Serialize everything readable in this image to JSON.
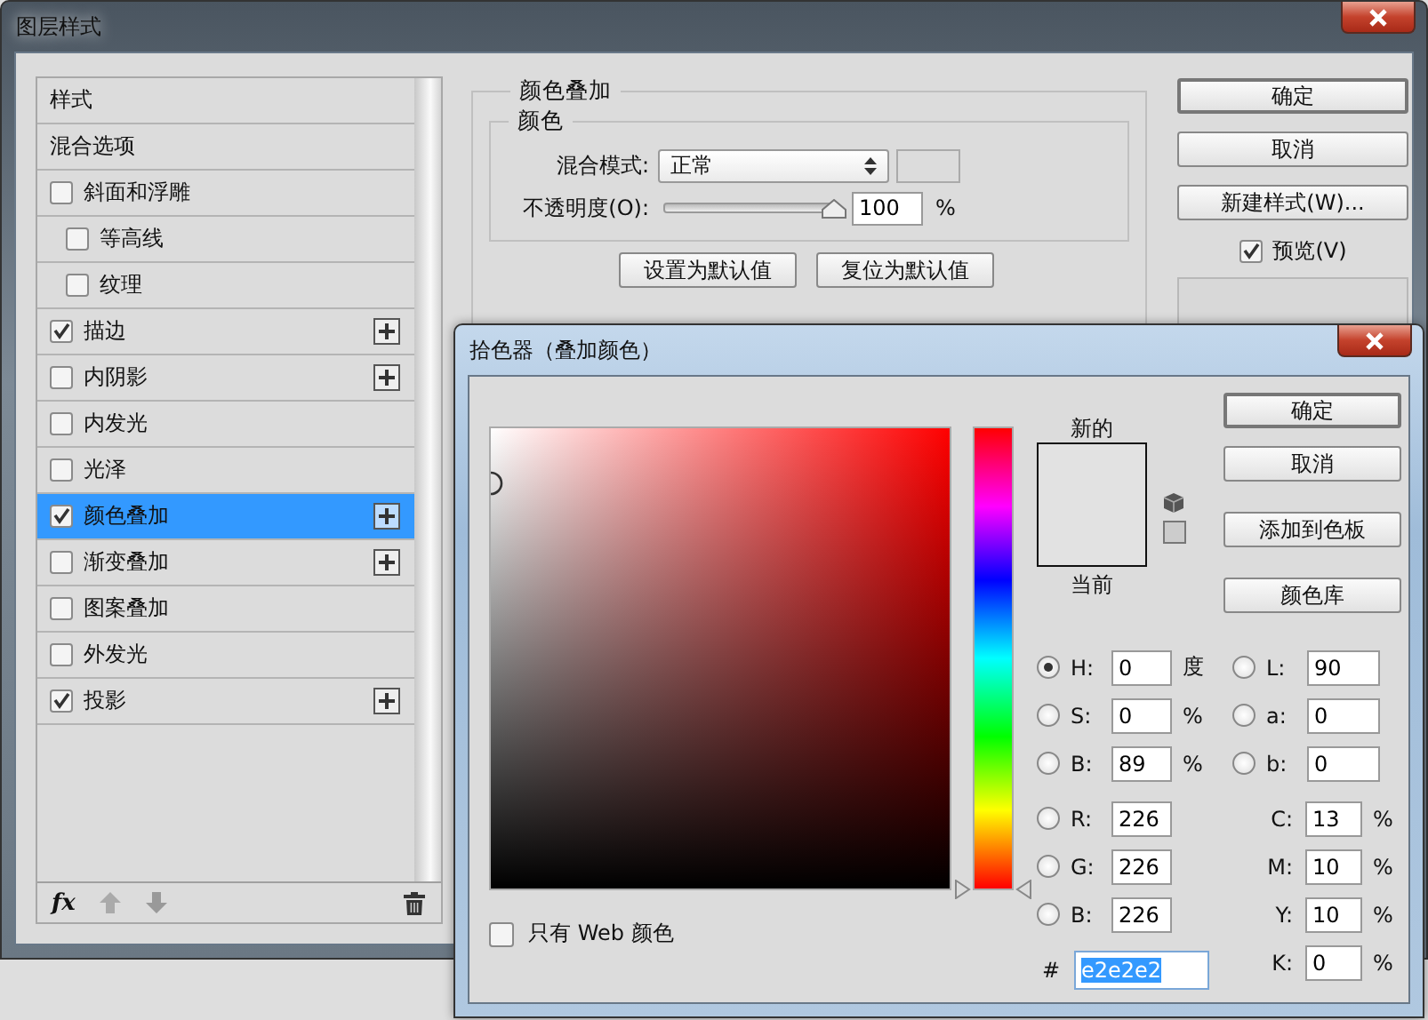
{
  "layer_style_window": {
    "title": "图层样式",
    "styles_list": [
      {
        "kind": "header",
        "label": "样式",
        "selected": false
      },
      {
        "kind": "header",
        "label": "混合选项",
        "selected": false
      },
      {
        "kind": "effect",
        "label": "斜面和浮雕",
        "checked": false,
        "addable": false,
        "selected": false,
        "children": [
          {
            "kind": "effect",
            "label": "等高线",
            "checked": false,
            "addable": false,
            "selected": false
          },
          {
            "kind": "effect",
            "label": "纹理",
            "checked": false,
            "addable": false,
            "selected": false
          }
        ]
      },
      {
        "kind": "effect",
        "label": "描边",
        "checked": true,
        "addable": true,
        "selected": false
      },
      {
        "kind": "effect",
        "label": "内阴影",
        "checked": false,
        "addable": true,
        "selected": false
      },
      {
        "kind": "effect",
        "label": "内发光",
        "checked": false,
        "addable": false,
        "selected": false
      },
      {
        "kind": "effect",
        "label": "光泽",
        "checked": false,
        "addable": false,
        "selected": false
      },
      {
        "kind": "effect",
        "label": "颜色叠加",
        "checked": true,
        "addable": true,
        "selected": true
      },
      {
        "kind": "effect",
        "label": "渐变叠加",
        "checked": false,
        "addable": true,
        "selected": false
      },
      {
        "kind": "effect",
        "label": "图案叠加",
        "checked": false,
        "addable": false,
        "selected": false
      },
      {
        "kind": "effect",
        "label": "外发光",
        "checked": false,
        "addable": false,
        "selected": false
      },
      {
        "kind": "effect",
        "label": "投影",
        "checked": true,
        "addable": true,
        "selected": false
      }
    ],
    "list_toolbar": {
      "fx_label": "fx"
    },
    "overlay_panel": {
      "title": "颜色叠加",
      "group_title": "颜色",
      "blend_mode_label": "混合模式:",
      "blend_mode_value": "正常",
      "opacity_label": "不透明度(O):",
      "opacity": {
        "level": 1,
        "value": "100",
        "unit": "%"
      },
      "buttons": [
        "设置为默认值",
        "复位为默认值"
      ]
    },
    "buttons": [
      {
        "label": "确定",
        "default": true
      },
      {
        "label": "取消",
        "default": false
      },
      {
        "label": "新建样式(W)...",
        "default": false
      }
    ],
    "preview": {
      "label": "预览(V)",
      "checked": true
    }
  },
  "color_picker_window": {
    "title": "拾色器（叠加颜色）",
    "web_only": {
      "label": "只有 Web 颜色",
      "checked": false
    },
    "hue_slider": {
      "level": 0
    },
    "new_label": "新的",
    "current_label": "当前",
    "buttons": [
      {
        "label": "确定",
        "default": true
      },
      {
        "label": "取消",
        "default": false
      },
      {
        "label": "添加到色板",
        "default": false
      },
      {
        "label": "颜色库",
        "default": false
      }
    ],
    "left_fields": [
      {
        "kind": "radio",
        "label": "H:",
        "value": "0",
        "unit": "度",
        "selected": true
      },
      {
        "kind": "radio",
        "label": "S:",
        "value": "0",
        "unit": "%",
        "selected": false
      },
      {
        "kind": "radio",
        "label": "B:",
        "value": "89",
        "unit": "%",
        "selected": false
      },
      {
        "kind": "radio",
        "label": "R:",
        "value": "226",
        "selected": false
      },
      {
        "kind": "radio",
        "label": "G:",
        "value": "226",
        "selected": false
      },
      {
        "kind": "radio",
        "label": "B:",
        "value": "226",
        "selected": false
      }
    ],
    "right_fields": [
      {
        "kind": "radio",
        "label": "L:",
        "value": "90",
        "selected": false
      },
      {
        "kind": "radio",
        "label": "a:",
        "value": "0",
        "selected": false
      },
      {
        "kind": "radio",
        "label": "b:",
        "value": "0",
        "selected": false
      },
      {
        "kind": "plain",
        "label": "C:",
        "value": "13",
        "unit": "%"
      },
      {
        "kind": "plain",
        "label": "M:",
        "value": "10",
        "unit": "%"
      },
      {
        "kind": "plain",
        "label": "Y:",
        "value": "10",
        "unit": "%"
      },
      {
        "kind": "plain",
        "label": "K:",
        "value": "0",
        "unit": "%"
      }
    ],
    "hex": {
      "label": "#",
      "value": "e2e2e2"
    }
  }
}
